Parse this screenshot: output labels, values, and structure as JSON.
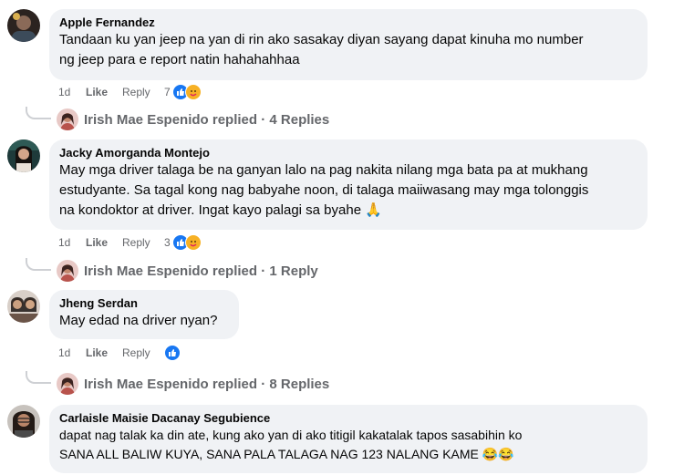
{
  "comments": [
    {
      "author": "Apple Fernandez",
      "text": "Tandaan ku yan jeep na yan di rin ako sasakay diyan sayang dapat kinuha mo number\nng jeep para e report natin hahahahhaa",
      "time": "1d",
      "like": "Like",
      "reply": "Reply",
      "reactions": "7",
      "replies": "Irish Mae Espenido replied · 4 Replies"
    },
    {
      "author": "Jacky Amorganda Montejo",
      "text": "May mga driver talaga be na ganyan lalo na pag nakita nilang mga bata pa at mukhang\nestudyante. Sa tagal kong nag babyahe noon, di talaga maiiwasang may mga tolonggis\nna kondoktor at driver. Ingat kayo palagi sa byahe 🙏",
      "time": "1d",
      "like": "Like",
      "reply": "Reply",
      "reactions": "3",
      "replies": "Irish Mae Espenido replied · 1 Reply"
    },
    {
      "author": "Jheng Serdan",
      "text": "May edad na driver nyan?",
      "time": "1d",
      "like": "Like",
      "reply": "Reply",
      "reactions": "",
      "replies": "Irish Mae Espenido replied · 8 Replies"
    },
    {
      "author": "Carlaisle Maisie Dacanay Segubience",
      "text": "dapat nag talak ka din ate, kung ako yan di ako titigil kakatalak tapos sasabihin ko\nSANA ALL BALIW KUYA, SANA PALA TALAGA NAG 123 NALANG KAME 😂😂"
    }
  ],
  "colors": {
    "bubble": "#f0f2f5",
    "meta": "#65676b",
    "like_blue": "#1877f2",
    "care_yellow": "#f7b125"
  }
}
